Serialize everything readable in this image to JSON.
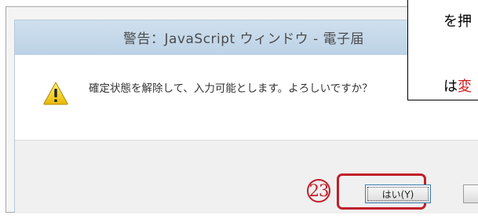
{
  "dialog": {
    "title": "警告：JavaScript ウィンドウ - 電子届",
    "message": "確定状態を解除して、入力可能とします。よろしいですか？",
    "buttons": {
      "yes_label": "はい(Y)"
    },
    "icon": "warning-icon"
  },
  "annotation": {
    "step_number": "23",
    "callout_line1": "を押",
    "callout_line2_prefix": "は",
    "callout_line2_highlight": "変",
    "highlight_color": "#c0202a"
  }
}
